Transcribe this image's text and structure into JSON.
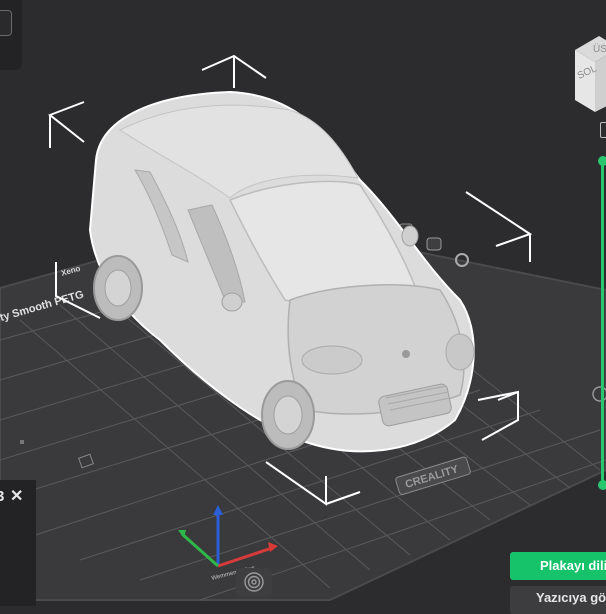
{
  "left_panel": {
    "text": "3",
    "close_glyph": "✕"
  },
  "view_cube": {
    "top_label": "ÜST",
    "side_label": "SOL"
  },
  "plate": {
    "filament_label": "ity Smooth PETG",
    "brand": "CREALITY",
    "model_name": "Xeno",
    "corner_label": "Wemmeniuetkus"
  },
  "buttons": {
    "slice_plate": "Plakayı dilimle",
    "send_printer": "Yazıcıya gönder"
  },
  "colors": {
    "accent": "#16c26a",
    "background": "#2c2c2e",
    "bed": "#3a3a3c",
    "grid": "#58585a",
    "model": "#dcdcdc",
    "bracket": "#ffffff"
  },
  "icons": [
    "close-icon",
    "view-cube-icon",
    "axis-gizmo-icon",
    "fingerprint-icon",
    "lock-icon",
    "gear-icon",
    "layers-icon"
  ]
}
